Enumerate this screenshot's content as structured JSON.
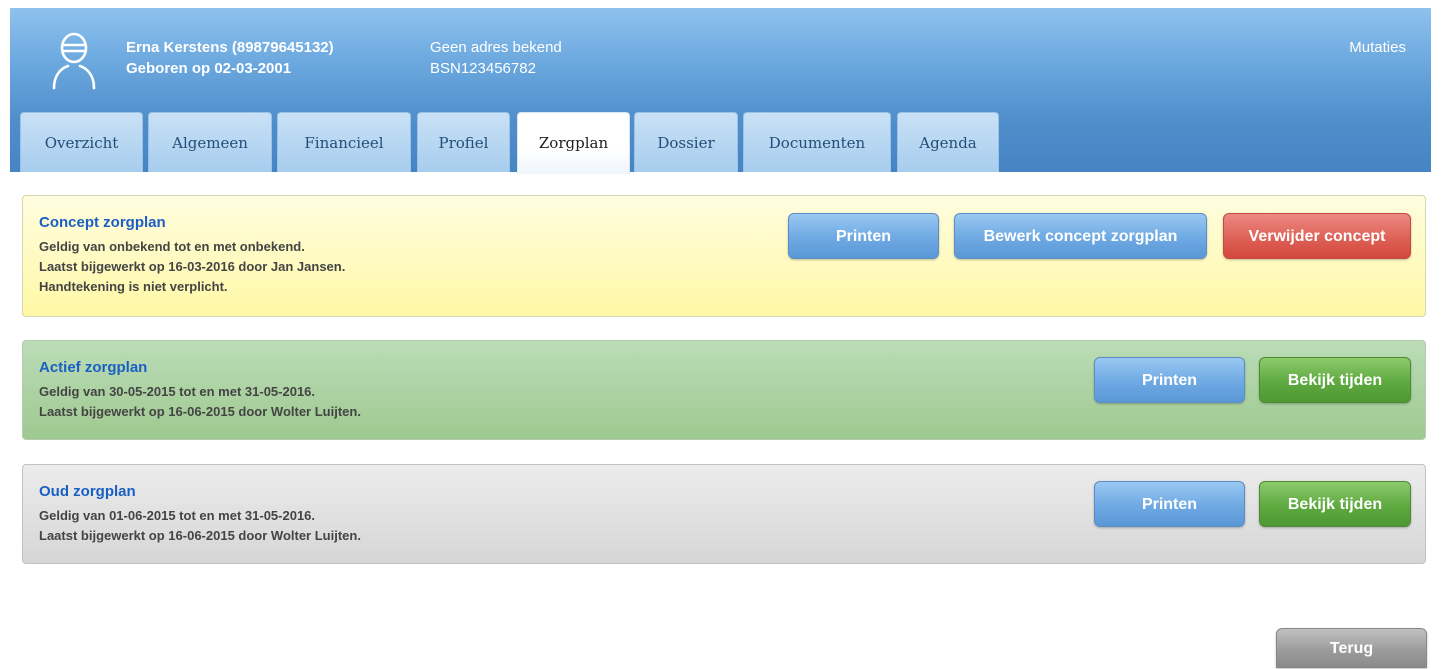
{
  "patient": {
    "name": "Erna Kerstens (89879645132)",
    "birth": "Geboren op 02-03-2001",
    "address": "Geen adres bekend",
    "bsn": "BSN123456782"
  },
  "header": {
    "mutaties_label": "Mutaties"
  },
  "tabs": [
    {
      "label": "Overzicht",
      "active": false
    },
    {
      "label": "Algemeen",
      "active": false
    },
    {
      "label": "Financieel",
      "active": false
    },
    {
      "label": "Profiel",
      "active": false
    },
    {
      "label": "Zorgplan",
      "active": true
    },
    {
      "label": "Dossier",
      "active": false
    },
    {
      "label": "Documenten",
      "active": false
    },
    {
      "label": "Agenda",
      "active": false
    }
  ],
  "panels": {
    "concept": {
      "title": "Concept zorgplan",
      "lines": [
        "Geldig van onbekend tot en met onbekend.",
        "Laatst bijgewerkt op 16-03-2016 door Jan Jansen.",
        "Handtekening is niet verplicht."
      ],
      "buttons": [
        "Printen",
        "Bewerk concept zorgplan",
        "Verwijder concept"
      ]
    },
    "actief": {
      "title": "Actief zorgplan",
      "lines": [
        "Geldig van 30-05-2015 tot en met 31-05-2016.",
        "Laatst bijgewerkt op 16-06-2015 door Wolter Luijten."
      ],
      "buttons": [
        "Printen",
        "Bekijk tijden"
      ]
    },
    "oud": {
      "title": "Oud zorgplan",
      "lines": [
        "Geldig van 01-06-2015 tot en met 31-05-2016.",
        "Laatst bijgewerkt op 16-06-2015 door Wolter Luijten."
      ],
      "buttons": [
        "Printen",
        "Bekijk tijden"
      ]
    }
  },
  "footer": {
    "back_label": "Terug"
  },
  "colors": {
    "header": "#4f8dcb",
    "title_link": "#1a5fc4",
    "btn_blue": "#6ea9e3",
    "btn_red": "#dd5e54",
    "btn_green": "#5ea940",
    "btn_grey": "#9c9c9c"
  },
  "icons": {
    "avatar": "user-avatar-icon"
  }
}
